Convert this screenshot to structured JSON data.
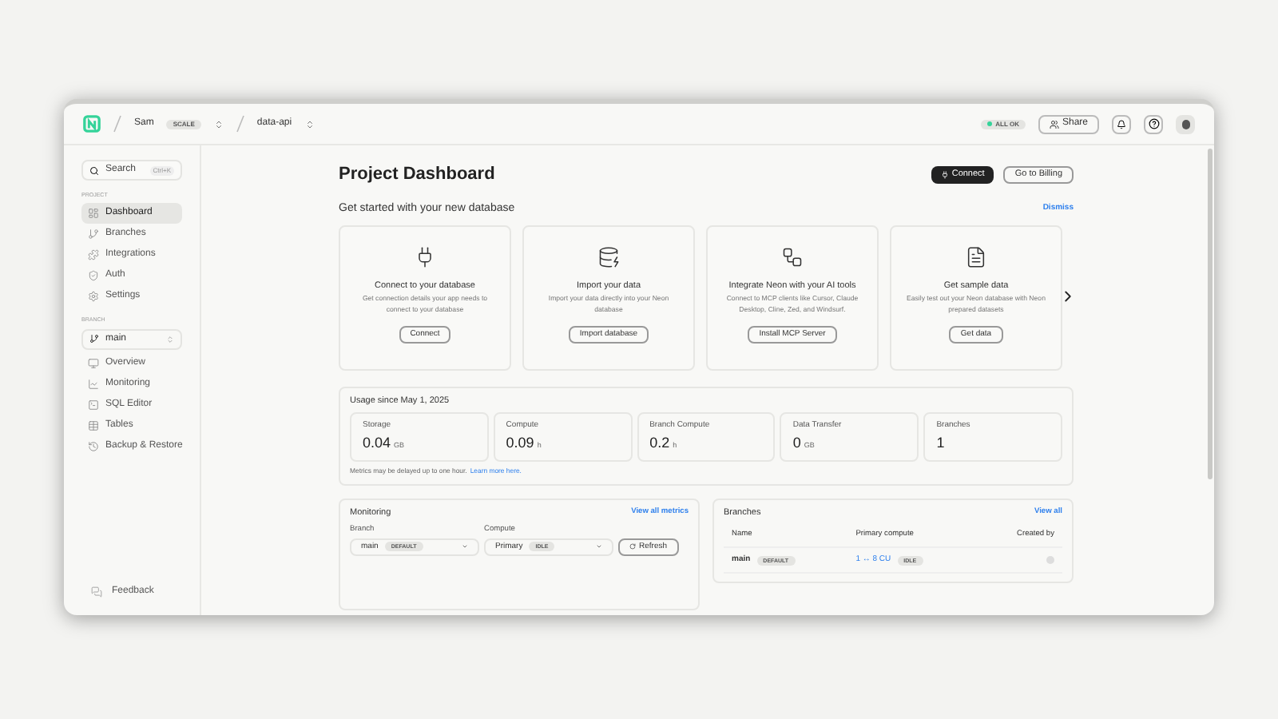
{
  "header": {
    "user": "Sam",
    "plan": "SCALE",
    "project": "data-api",
    "status": "ALL OK",
    "share": "Share"
  },
  "sidebar": {
    "search": {
      "placeholder": "Search",
      "shortcut": "Ctrl+K"
    },
    "project_label": "PROJECT",
    "project_items": [
      {
        "label": "Dashboard",
        "selected": true
      },
      {
        "label": "Branches",
        "selected": false
      },
      {
        "label": "Integrations",
        "selected": false
      },
      {
        "label": "Auth",
        "selected": false
      },
      {
        "label": "Settings",
        "selected": false
      }
    ],
    "branch_label": "BRANCH",
    "branch_select": "main",
    "branch_items": [
      {
        "label": "Overview",
        "selected": false
      },
      {
        "label": "Monitoring",
        "selected": false
      },
      {
        "label": "SQL Editor",
        "selected": false
      },
      {
        "label": "Tables",
        "selected": false
      },
      {
        "label": "Backup & Restore",
        "selected": false
      }
    ],
    "feedback": "Feedback"
  },
  "main": {
    "title": "Project Dashboard",
    "connect": "Connect",
    "billing": "Go to Billing",
    "getting_started": {
      "title": "Get started with your new database",
      "dismiss": "Dismiss",
      "cards": [
        {
          "title": "Connect to your database",
          "text": "Get connection details your app needs to connect to your database",
          "button": "Connect"
        },
        {
          "title": "Import your data",
          "text": "Import your data directly into your Neon database",
          "button": "Import database"
        },
        {
          "title": "Integrate Neon with your AI tools",
          "text": "Connect to MCP clients like Cursor, Claude Desktop, Cline, Zed, and Windsurf.",
          "button": "Install MCP Server"
        },
        {
          "title": "Get sample data",
          "text": "Easily test out your Neon database with Neon prepared datasets",
          "button": "Get data"
        }
      ]
    },
    "usage": {
      "title": "Usage since May 1, 2025",
      "metrics": [
        {
          "label": "Storage",
          "value": "0.04",
          "unit": "GB"
        },
        {
          "label": "Compute",
          "value": "0.09",
          "unit": "h"
        },
        {
          "label": "Branch Compute",
          "value": "0.2",
          "unit": "h"
        },
        {
          "label": "Data Transfer",
          "value": "0",
          "unit": "GB"
        },
        {
          "label": "Branches",
          "value": "1"
        }
      ],
      "note": "Metrics may be delayed up to one hour.",
      "link": "Learn more here."
    },
    "monitoring": {
      "title": "Monitoring",
      "link": "View all metrics",
      "branch_label": "Branch",
      "branch_value": "main",
      "branch_badge": "DEFAULT",
      "compute_label": "Compute",
      "compute_value": "Primary",
      "compute_badge": "IDLE",
      "refresh": "Refresh"
    },
    "branches": {
      "title": "Branches",
      "link": "View all",
      "columns": [
        "Name",
        "Primary compute",
        "Created by"
      ],
      "rows": [
        {
          "name": "main",
          "badge": "DEFAULT",
          "compute": "1 ↔ 8 CU",
          "state": "IDLE"
        }
      ]
    }
  }
}
